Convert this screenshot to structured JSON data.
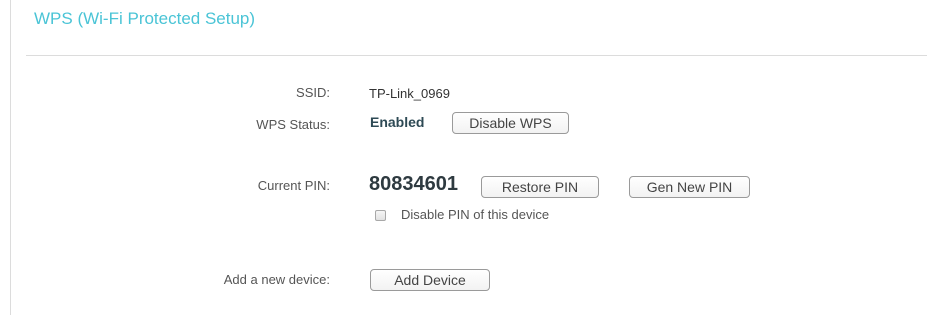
{
  "section": {
    "title": "WPS (Wi-Fi Protected Setup)"
  },
  "ssid": {
    "label": "SSID:",
    "value": "TP-Link_0969"
  },
  "wps_status": {
    "label": "WPS Status:",
    "value": "Enabled",
    "button_label": "Disable WPS"
  },
  "current_pin": {
    "label": "Current PIN:",
    "value": "80834601",
    "restore_button_label": "Restore PIN",
    "gen_button_label": "Gen New PIN",
    "disable_checkbox_label": "Disable PIN of this device",
    "disable_checked": false
  },
  "add_device": {
    "label": "Add a new device:",
    "button_label": "Add Device"
  },
  "colors": {
    "title": "#4ac4d6",
    "status": "#2e4a55"
  }
}
